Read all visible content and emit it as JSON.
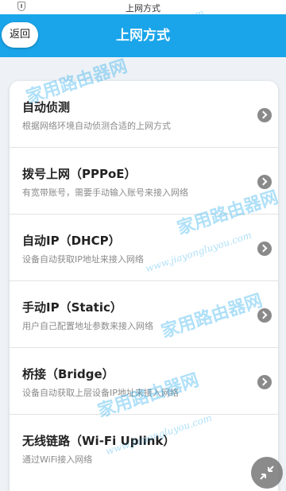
{
  "status_bar": {
    "title": "上网方式"
  },
  "header": {
    "back_label": "返回",
    "title": "上网方式"
  },
  "items": [
    {
      "label": "自动侦测",
      "desc": "根据网络环境自动侦测合适的上网方式"
    },
    {
      "label": "拨号上网（PPPoE）",
      "desc": "有宽带账号，需要手动输入账号来接入网络"
    },
    {
      "label": "自动IP（DHCP）",
      "desc": "设备自动获取IP地址来接入网络"
    },
    {
      "label": "手动IP（Static）",
      "desc": "用户自己配置地址参数来接入网络"
    },
    {
      "label": "桥接（Bridge）",
      "desc": "设备自动获取上层设备IP地址来接入网络"
    },
    {
      "label": "无线链路（Wi-Fi Uplink）",
      "desc": "通过WiFi接入网络"
    }
  ],
  "watermark": {
    "brand": "家用路由器网",
    "url": "www.jiayongluyou.com"
  },
  "colors": {
    "header": "#1aa5ea",
    "arrow": "#8a8a8a"
  }
}
